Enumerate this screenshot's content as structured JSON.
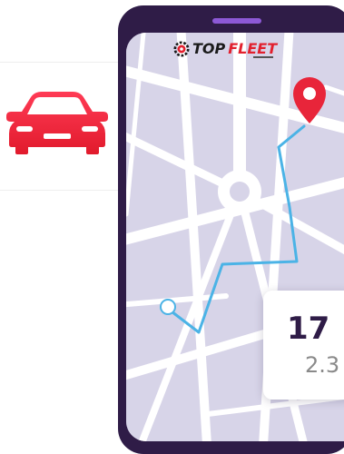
{
  "logo": {
    "top": "TOP",
    "fleet": "FLEET"
  },
  "trip": {
    "time": "17",
    "distance": "2.3"
  },
  "icons": {
    "car": "car-icon",
    "destination": "map-pin-icon",
    "origin": "origin-dot-icon",
    "brand": "gear-logo-icon"
  },
  "colors": {
    "car": "#f0213a",
    "phone_frame": "#2f1c47",
    "speaker": "#8d59d6",
    "map_background": "#d7d4e8",
    "road": "#ffffff",
    "route": "#4bb3e6",
    "pin": "#e8253a",
    "brand_red": "#e2202e"
  }
}
